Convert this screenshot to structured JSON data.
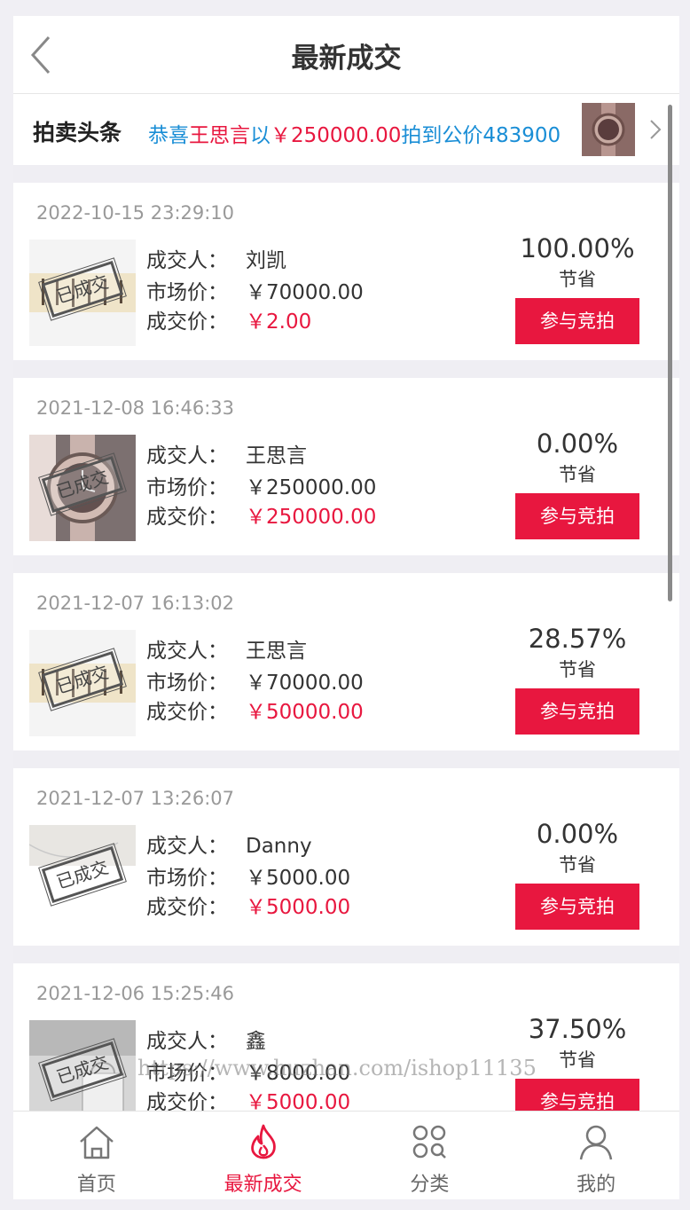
{
  "header": {
    "title": "最新成交"
  },
  "headline": {
    "label": "拍卖头条",
    "prefix": "恭喜",
    "winner": "王思言",
    "mid": "以",
    "price": "￥250000.00",
    "suffix": "拍到公价483900"
  },
  "records": [
    {
      "date": "2022-10-15 23:29:10",
      "buyer_label": "成交人：",
      "buyer": "刘凯",
      "market_label": "市场价：",
      "market": "￥70000.00",
      "deal_label": "成交价：",
      "deal": "￥2.00",
      "percent": "100.00%",
      "save_label": "节省",
      "button": "参与竞拍",
      "stamp": "已成交",
      "thumb": "calligraphy"
    },
    {
      "date": "2021-12-08 16:46:33",
      "buyer_label": "成交人：",
      "buyer": "王思言",
      "market_label": "市场价：",
      "market": "￥250000.00",
      "deal_label": "成交价：",
      "deal": "￥250000.00",
      "percent": "0.00%",
      "save_label": "节省",
      "button": "参与竞拍",
      "stamp": "已成交",
      "thumb": "watch"
    },
    {
      "date": "2021-12-07 16:13:02",
      "buyer_label": "成交人：",
      "buyer": "王思言",
      "market_label": "市场价：",
      "market": "￥70000.00",
      "deal_label": "成交价：",
      "deal": "￥50000.00",
      "percent": "28.57%",
      "save_label": "节省",
      "button": "参与竞拍",
      "stamp": "已成交",
      "thumb": "calligraphy"
    },
    {
      "date": "2021-12-07 13:26:07",
      "buyer_label": "成交人：",
      "buyer": "Danny",
      "market_label": "市场价：",
      "market": "￥5000.00",
      "deal_label": "成交价：",
      "deal": "￥5000.00",
      "percent": "0.00%",
      "save_label": "节省",
      "button": "参与竞拍",
      "stamp": "已成交",
      "thumb": "necklace"
    },
    {
      "date": "2021-12-06 15:25:46",
      "buyer_label": "成交人：",
      "buyer": "鑫",
      "market_label": "市场价：",
      "market": "￥8000.00",
      "deal_label": "成交价：",
      "deal": "￥5000.00",
      "percent": "37.50%",
      "save_label": "节省",
      "button": "参与竞拍",
      "stamp": "已成交",
      "thumb": "bag"
    }
  ],
  "watermark": "https://www.huzhan.com/ishop11135",
  "tabs": [
    {
      "label": "首页",
      "icon": "home-icon",
      "active": false
    },
    {
      "label": "最新成交",
      "icon": "flame-icon",
      "active": true
    },
    {
      "label": "分类",
      "icon": "category-icon",
      "active": false
    },
    {
      "label": "我的",
      "icon": "user-icon",
      "active": false
    }
  ],
  "colors": {
    "accent": "#e8173f",
    "link": "#1a8ed6"
  }
}
